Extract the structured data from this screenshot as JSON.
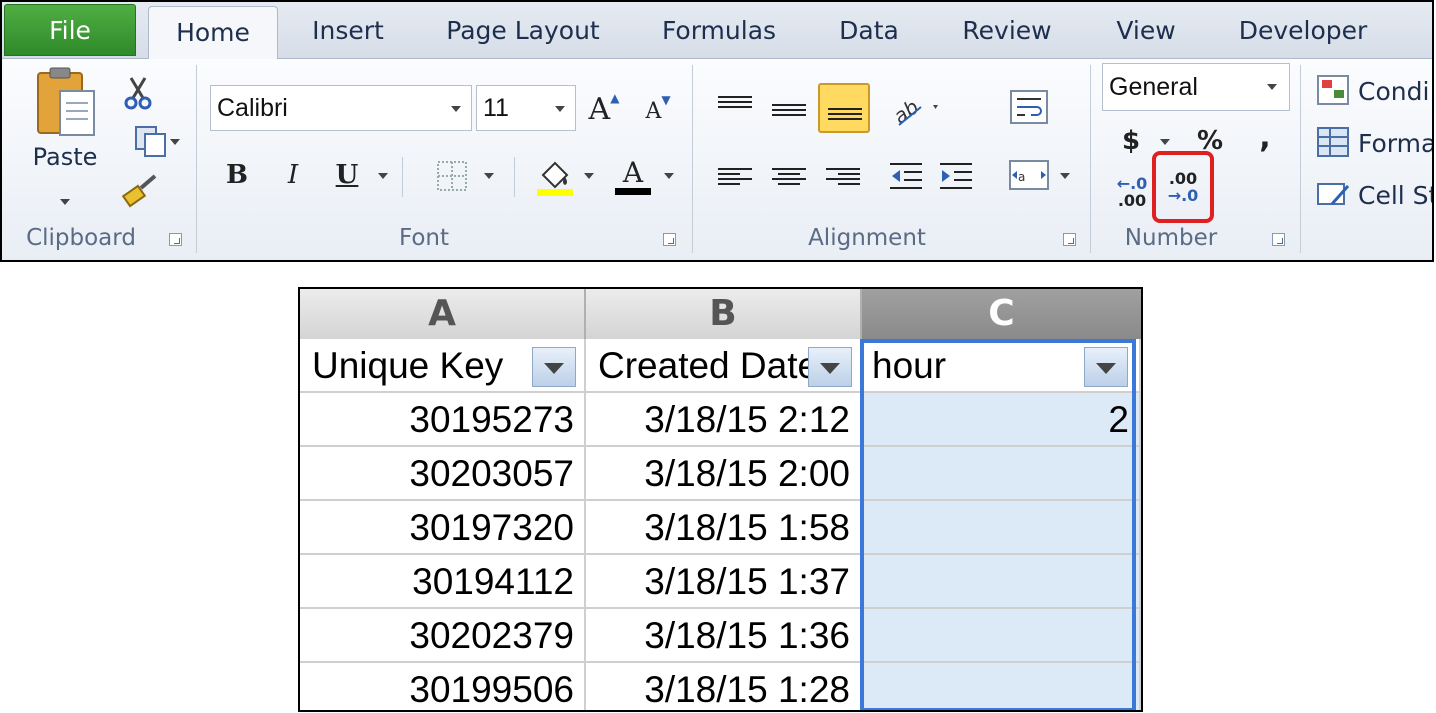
{
  "tabs": [
    "File",
    "Home",
    "Insert",
    "Page Layout",
    "Formulas",
    "Data",
    "Review",
    "View",
    "Developer"
  ],
  "clipboard": {
    "paste_label": "Paste",
    "group_label": "Clipboard"
  },
  "font": {
    "name": "Calibri",
    "size": "11",
    "group_label": "Font",
    "bold": "B",
    "italic": "I",
    "underline": "U",
    "grow": "A",
    "shrink": "A",
    "color": "A"
  },
  "alignment": {
    "group_label": "Alignment"
  },
  "number": {
    "format": "General",
    "currency": "$",
    "percent": "%",
    "comma": ",",
    "increase_decimal_top": "←.0",
    "increase_decimal_bottom": ".00",
    "decrease_decimal_top": ".00",
    "decrease_decimal_bottom": "→.0",
    "group_label": "Number",
    "highlight_color": "#e02020"
  },
  "styles": {
    "conditional": "Condi",
    "format": "Forma",
    "cell": "Cell St"
  },
  "sheet": {
    "columns": [
      "A",
      "B",
      "C"
    ],
    "headers": [
      "Unique Key",
      "Created Date",
      "hour"
    ],
    "rows": [
      [
        "30195273",
        "3/18/15 2:12",
        "2"
      ],
      [
        "30203057",
        "3/18/15 2:00",
        ""
      ],
      [
        "30197320",
        "3/18/15 1:58",
        ""
      ],
      [
        "30194112",
        "3/18/15 1:37",
        ""
      ],
      [
        "30202379",
        "3/18/15 1:36",
        ""
      ],
      [
        "30199506",
        "3/18/15 1:28",
        ""
      ]
    ],
    "selection_color": "#3c78d8"
  }
}
